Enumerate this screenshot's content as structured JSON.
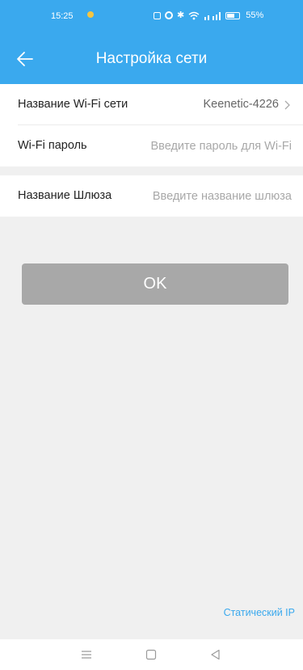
{
  "status_bar": {
    "time": "15:25",
    "battery_level": 55,
    "battery_text": "55%",
    "icons": [
      "notification-box-icon",
      "settings-icon",
      "bluetooth-icon",
      "wifi-icon",
      "signal-icon",
      "battery-icon"
    ]
  },
  "header": {
    "title": "Настройка сети",
    "background_color": "#3aa9ee"
  },
  "form": {
    "wifi_name": {
      "label": "Название Wi-Fi сети",
      "value": "Keenetic-4226"
    },
    "wifi_password": {
      "label": "Wi-Fi пароль",
      "placeholder": "Введите пароль для Wi-Fi",
      "value": ""
    },
    "gateway_name": {
      "label": "Название Шлюза",
      "placeholder": "Введите название шлюза",
      "value": ""
    }
  },
  "ok_button": {
    "label": "OK",
    "color": "#a8a8a8"
  },
  "static_ip_link": {
    "label": "Статический IP",
    "color": "#3aa9ee"
  },
  "navbar": {
    "buttons": [
      "menu-icon",
      "home-icon",
      "back-triangle-icon"
    ]
  }
}
